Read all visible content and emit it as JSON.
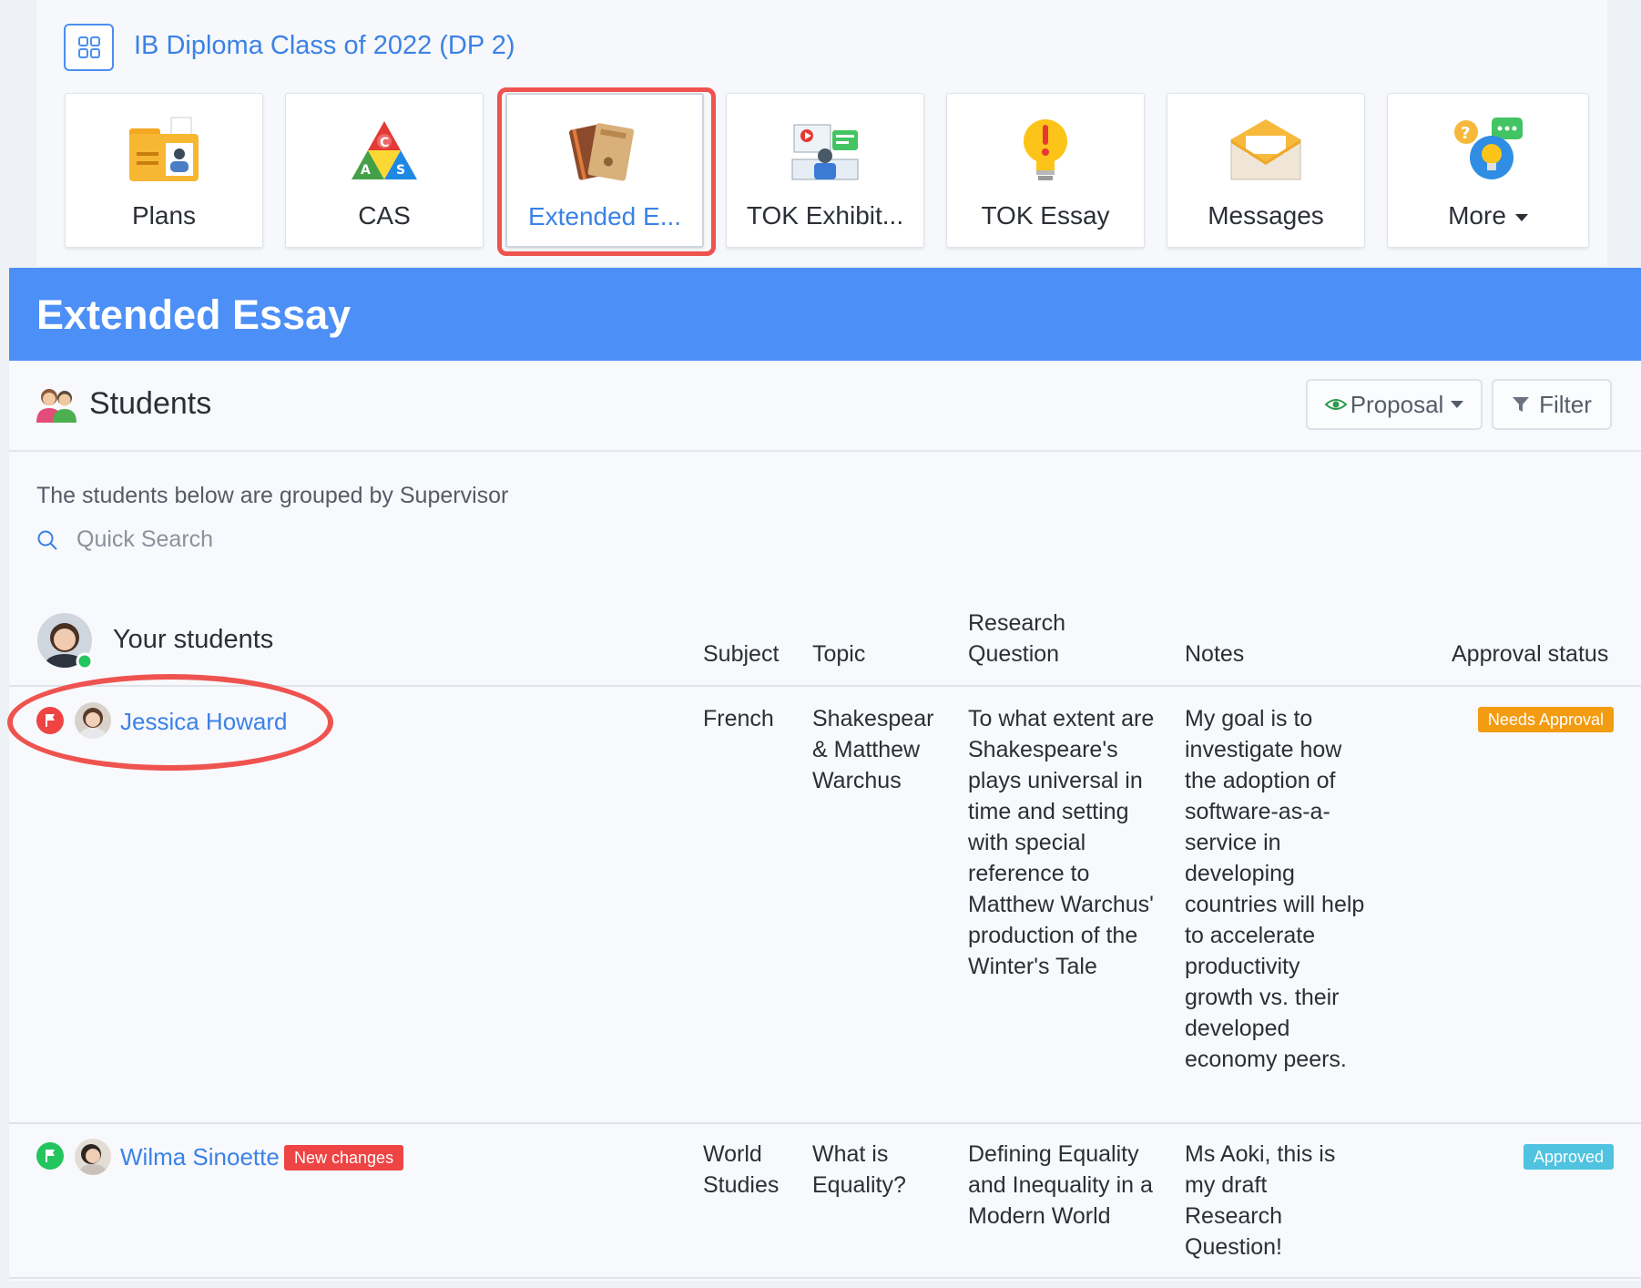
{
  "class_title": "IB Diploma Class of 2022 (DP 2)",
  "apps": [
    {
      "label": "Plans",
      "icon": "plans-folder-icon"
    },
    {
      "label": "CAS",
      "icon": "cas-triangle-icon"
    },
    {
      "label": "Extended E...",
      "icon": "extended-essay-books-icon"
    },
    {
      "label": "TOK Exhibit...",
      "icon": "tok-exhibition-icon"
    },
    {
      "label": "TOK Essay",
      "icon": "tok-essay-bulb-icon"
    },
    {
      "label": "Messages",
      "icon": "messages-envelope-icon"
    },
    {
      "label": "More",
      "icon": "more-help-icon"
    }
  ],
  "banner_title": "Extended Essay",
  "students": {
    "title": "Students",
    "proposal_label": "Proposal",
    "filter_label": "Filter",
    "hint": "The students below are grouped by Supervisor",
    "search_placeholder": "Quick Search",
    "group_title": "Your students",
    "columns": {
      "subject": "Subject",
      "topic": "Topic",
      "research_question": "Research Question",
      "notes": "Notes",
      "approval": "Approval status"
    },
    "rows": [
      {
        "name": "Jessica Howard",
        "flag_color": "#ef4444",
        "subject": "French",
        "topic": "Shakespear & Matthew Warchus",
        "research_question": "To what extent are Shakespeare's plays universal in time and setting with special reference to Matthew Warchus' production of the Winter's Tale",
        "notes": "My goal is to investigate how the adoption of software-as-a-service in developing countries will help to accelerate productivity growth vs. their developed economy peers.",
        "status": "Needs Approval",
        "status_color": "#f39c12"
      },
      {
        "name": "Wilma Sinoette",
        "tag": "New changes",
        "flag_color": "#22c55e",
        "subject": "World Studies",
        "topic": "What is Equality?",
        "research_question": "Defining Equality and Inequality in a Modern World",
        "notes": "Ms Aoki, this is my draft Research Question!",
        "status": "Approved",
        "status_color": "#4fc3e0"
      }
    ]
  }
}
